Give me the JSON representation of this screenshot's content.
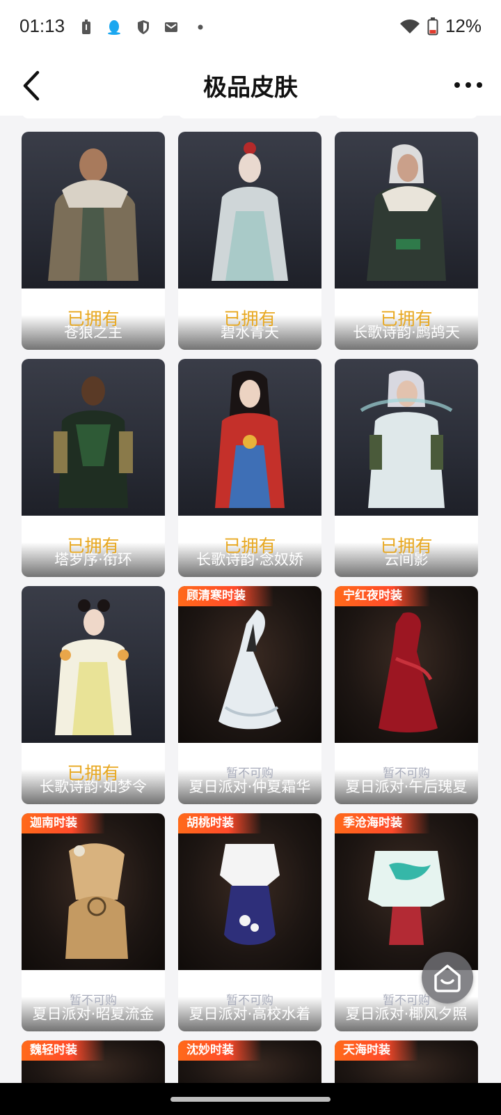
{
  "status_bar": {
    "time": "01:13",
    "battery": "12%",
    "icons": [
      "battery-saver-icon",
      "qq-icon",
      "shield-icon",
      "mail-icon",
      "dot-icon",
      "wifi-icon",
      "battery-icon"
    ]
  },
  "header": {
    "title": "极品皮肤",
    "back_icon": "chevron-left-icon",
    "more_icon": "more-dots-icon"
  },
  "skins": [
    {
      "name": "苍狼之主",
      "status": "已拥有",
      "tag": ""
    },
    {
      "name": "碧水青天",
      "status": "已拥有",
      "tag": ""
    },
    {
      "name": "长歌诗韵·鹧鸪天",
      "status": "已拥有",
      "tag": ""
    },
    {
      "name": "塔罗序·衔环",
      "status": "已拥有",
      "tag": ""
    },
    {
      "name": "长歌诗韵·念奴娇",
      "status": "已拥有",
      "tag": ""
    },
    {
      "name": "云间影",
      "status": "已拥有",
      "tag": ""
    },
    {
      "name": "长歌诗韵·如梦令",
      "status": "已拥有",
      "tag": ""
    },
    {
      "name": "夏日派对·仲夏霜华",
      "status": "暂不可购",
      "tag": "顾清寒时装"
    },
    {
      "name": "夏日派对·午后瑰夏",
      "status": "暂不可购",
      "tag": "宁红夜时装"
    },
    {
      "name": "夏日派对·昭夏流金",
      "status": "暂不可购",
      "tag": "迦南时装"
    },
    {
      "name": "夏日派对·高校水着",
      "status": "暂不可购",
      "tag": "胡桃时装"
    },
    {
      "name": "夏日派对·椰风夕照",
      "status": "暂不可购",
      "tag": "季沧海时装"
    }
  ],
  "peek_tags": [
    "魏轻时装",
    "沈妙时装",
    "天海时装"
  ],
  "colors": {
    "owned": "#e8a820",
    "unavailable": "#a8acbb",
    "tag": "#ff5a22"
  }
}
